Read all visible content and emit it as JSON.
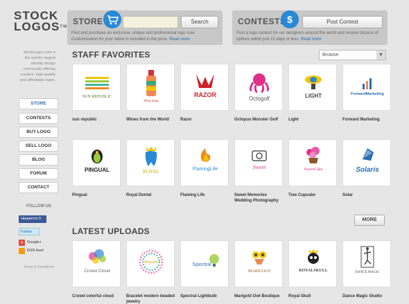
{
  "logo": {
    "line1": "STOCK",
    "line2": "LOGOS",
    "tm": "TM"
  },
  "store": {
    "title": "STORE",
    "badge_icon": "cart-icon",
    "search_placeholder": "",
    "search_label": "Search",
    "description": "Find and purchase an exclusive, unique and professional logo now. Customization for your name is included in the price.",
    "more": "Read more"
  },
  "contests": {
    "title": "CONTESTS",
    "badge_icon": "dollar-icon",
    "badge_glyph": "$",
    "post_label": "Post Contest",
    "description": "Post a logo contest for our designers around the world and receive dozens of options within just 10 days or less.",
    "more": "Read more"
  },
  "sidebar": {
    "about": "StockLogos.com is the world's largest identity design community offering creative, high-quality and affordable logos.",
    "nav": [
      "STORE",
      "CONTESTS",
      "BUY LOGO",
      "SELL LOGO",
      "BLOG",
      "FORUM",
      "CONTACT"
    ],
    "follow": "FOLLOW US",
    "facebook": "Нравится",
    "facebook_count": "0",
    "twitter": "Follow",
    "google": "Google+",
    "rss": "RSS feed",
    "terms": "Terms & Conditions"
  },
  "staff": {
    "title": "STAFF FAVORITES",
    "browse": "Browse",
    "row1": [
      "sun republic",
      "Wines from the World",
      "Razor",
      "Octopus Monster Golf",
      "Light",
      "Forward Marketing"
    ],
    "row2": [
      "Pingual",
      "Royal Dental",
      "Flaming Life",
      "Sweet Memories Wedding Photography",
      "Tree Cupcake",
      "Solar"
    ],
    "art1": [
      "SUN REPUBLIC",
      "Wine shop",
      "RAZOR",
      "Octogolf",
      "LIGHT",
      "ForwardMarketing"
    ],
    "art2": [
      "PINGUAL",
      "ROYAL",
      "FlamingLife",
      "Sweet",
      "SweetCake",
      "Solaris"
    ],
    "more": "MORE"
  },
  "latest": {
    "title": "LATEST UPLOADS",
    "row": [
      "Crowd colorful cloud",
      "Bracelet modern beaded jewelry",
      "Spectral Lightbulb",
      "Marigold Owl Boutique",
      "Royal Skull",
      "Dance Magic Studio"
    ],
    "art": [
      "Crowd Cloud",
      "Bracelet",
      "Spectral",
      "MARIGOLD",
      "ROYALSKULL",
      "DANCE MAGIC"
    ]
  },
  "colors": {
    "accent": "#2a89d4",
    "razor": "#d0202a",
    "link": "#2a6db0"
  }
}
